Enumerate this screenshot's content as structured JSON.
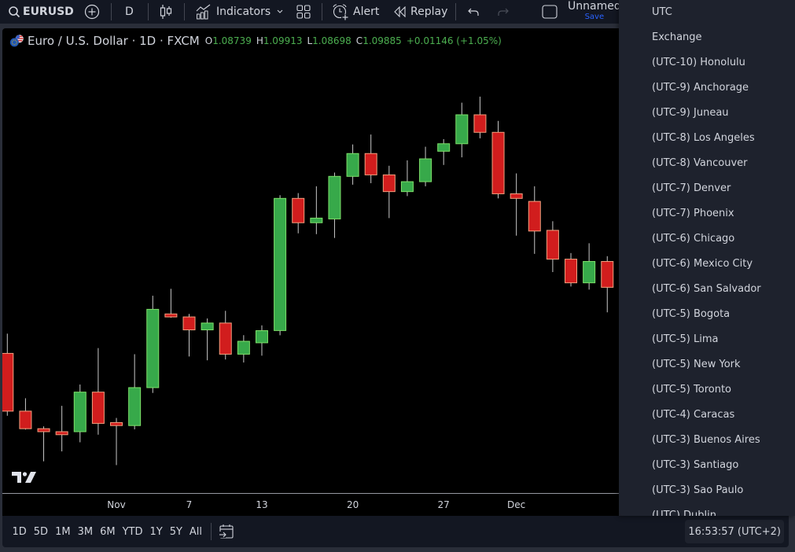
{
  "toolbar": {
    "symbol": "EURUSD",
    "interval": "D",
    "indicators_label": "Indicators",
    "alert_label": "Alert",
    "replay_label": "Replay",
    "layout_name": "Unnamed",
    "save_label": "Save"
  },
  "legend": {
    "title": "Euro / U.S. Dollar · 1D · FXCM",
    "open_key": "O",
    "open": "1.08739",
    "high_key": "H",
    "high": "1.09913",
    "low_key": "L",
    "low": "1.08698",
    "close_key": "C",
    "close": "1.09885",
    "change": "+0.01146 (+1.05%)"
  },
  "colors": {
    "up": "#37a94a",
    "up_border": "#7ee06a",
    "down": "#d11d1d",
    "down_border": "#f2a07f",
    "wick": "#c8c8c8",
    "legend_value": "#4caf50"
  },
  "bottom_bar": {
    "ranges": [
      "1D",
      "5D",
      "1M",
      "3M",
      "6M",
      "YTD",
      "1Y",
      "5Y",
      "All"
    ],
    "clock": "16:53:57 (UTC+2)"
  },
  "timezone_menu": {
    "items": [
      "UTC",
      "Exchange",
      "(UTC-10) Honolulu",
      "(UTC-9) Anchorage",
      "(UTC-9) Juneau",
      "(UTC-8) Los Angeles",
      "(UTC-8) Vancouver",
      "(UTC-7) Denver",
      "(UTC-7) Phoenix",
      "(UTC-6) Chicago",
      "(UTC-6) Mexico City",
      "(UTC-6) San Salvador",
      "(UTC-5) Bogota",
      "(UTC-5) Lima",
      "(UTC-5) New York",
      "(UTC-5) Toronto",
      "(UTC-4) Caracas",
      "(UTC-3) Buenos Aires",
      "(UTC-3) Santiago",
      "(UTC-3) Sao Paulo",
      "(UTC) Dublin"
    ]
  },
  "chart_data": {
    "type": "candlestick",
    "title": "Euro / U.S. Dollar · 1D · FXCM",
    "xlabel": "",
    "ylabel": "",
    "x_tick_labels": [
      {
        "label": "Nov",
        "index": 6
      },
      {
        "label": "7",
        "index": 10
      },
      {
        "label": "13",
        "index": 14
      },
      {
        "label": "20",
        "index": 19
      },
      {
        "label": "27",
        "index": 24
      },
      {
        "label": "Dec",
        "index": 28
      }
    ],
    "ylim": [
      1.0733,
      1.1136
    ],
    "grid": false,
    "candles": [
      {
        "o": 1.08541,
        "h": 1.08712,
        "l": 1.08,
        "c": 1.0804
      },
      {
        "o": 1.0804,
        "h": 1.08152,
        "l": 1.0788,
        "c": 1.07888
      },
      {
        "o": 1.07888,
        "h": 1.07908,
        "l": 1.07605,
        "c": 1.07862
      },
      {
        "o": 1.07862,
        "h": 1.08086,
        "l": 1.07691,
        "c": 1.07836
      },
      {
        "o": 1.07862,
        "h": 1.08271,
        "l": 1.0777,
        "c": 1.08205
      },
      {
        "o": 1.08205,
        "h": 1.08587,
        "l": 1.07836,
        "c": 1.07934
      },
      {
        "o": 1.07941,
        "h": 1.07981,
        "l": 1.07572,
        "c": 1.07915
      },
      {
        "o": 1.07915,
        "h": 1.08534,
        "l": 1.07882,
        "c": 1.08244
      },
      {
        "o": 1.08244,
        "h": 1.09041,
        "l": 1.08198,
        "c": 1.08923
      },
      {
        "o": 1.08883,
        "h": 1.09101,
        "l": 1.0885,
        "c": 1.08857
      },
      {
        "o": 1.08857,
        "h": 1.08883,
        "l": 1.08514,
        "c": 1.08745
      },
      {
        "o": 1.08745,
        "h": 1.08844,
        "l": 1.08481,
        "c": 1.08804
      },
      {
        "o": 1.08804,
        "h": 1.0891,
        "l": 1.08488,
        "c": 1.08534
      },
      {
        "o": 1.08534,
        "h": 1.08699,
        "l": 1.08462,
        "c": 1.08646
      },
      {
        "o": 1.08633,
        "h": 1.08784,
        "l": 1.08521,
        "c": 1.08738
      },
      {
        "o": 1.08739,
        "h": 1.09913,
        "l": 1.08698,
        "c": 1.09885
      },
      {
        "o": 1.09885,
        "h": 1.09931,
        "l": 1.09582,
        "c": 1.09674
      },
      {
        "o": 1.09674,
        "h": 1.0999,
        "l": 1.09575,
        "c": 1.09714
      },
      {
        "o": 1.09707,
        "h": 1.10109,
        "l": 1.09542,
        "c": 1.10076
      },
      {
        "o": 1.10076,
        "h": 1.10353,
        "l": 1.10004,
        "c": 1.10274
      },
      {
        "o": 1.10274,
        "h": 1.10439,
        "l": 1.10017,
        "c": 1.10089
      },
      {
        "o": 1.10089,
        "h": 1.10168,
        "l": 1.09714,
        "c": 1.09944
      },
      {
        "o": 1.09944,
        "h": 1.10215,
        "l": 1.09905,
        "c": 1.1003
      },
      {
        "o": 1.1003,
        "h": 1.10333,
        "l": 1.0999,
        "c": 1.10228
      },
      {
        "o": 1.10294,
        "h": 1.10399,
        "l": 1.10175,
        "c": 1.10359
      },
      {
        "o": 1.10359,
        "h": 1.10715,
        "l": 1.10241,
        "c": 1.1061
      },
      {
        "o": 1.1061,
        "h": 1.10768,
        "l": 1.10406,
        "c": 1.10458
      },
      {
        "o": 1.10458,
        "h": 1.10557,
        "l": 1.09885,
        "c": 1.09925
      },
      {
        "o": 1.09925,
        "h": 1.10102,
        "l": 1.09562,
        "c": 1.09885
      },
      {
        "o": 1.09859,
        "h": 1.0999,
        "l": 1.09404,
        "c": 1.09602
      },
      {
        "o": 1.09608,
        "h": 1.09687,
        "l": 1.09246,
        "c": 1.09358
      },
      {
        "o": 1.09358,
        "h": 1.09411,
        "l": 1.09121,
        "c": 1.09153
      },
      {
        "o": 1.09153,
        "h": 1.09496,
        "l": 1.09094,
        "c": 1.09338
      },
      {
        "o": 1.09338,
        "h": 1.09384,
        "l": 1.08897,
        "c": 1.09114
      }
    ]
  }
}
